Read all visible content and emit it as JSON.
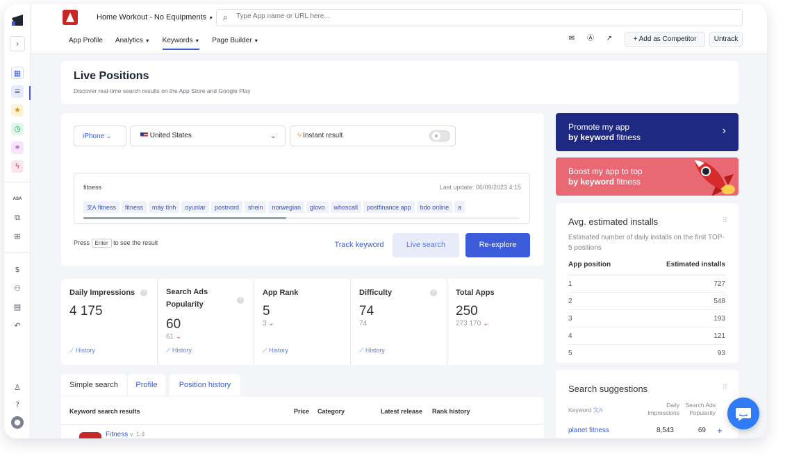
{
  "app": {
    "name": "Home Workout - No Equipments"
  },
  "search": {
    "placeholder": "Type App name or URL here..."
  },
  "nav": {
    "items": [
      "App Profile",
      "Analytics",
      "Keywords",
      "Page Builder"
    ]
  },
  "toolbar": {
    "add_competitor": "Add as Competitor",
    "untrack": "Untrack"
  },
  "page": {
    "title": "Live Positions",
    "subtitle": "Discover real-time search results on the App Store and Google Play"
  },
  "controls": {
    "device": "iPhone",
    "country": "United States",
    "instant": "Instant result"
  },
  "keyword_box": {
    "query": "fitness",
    "last_update": "Last update: 06/09/2023 4:15",
    "chips": [
      "fitness",
      "fitness",
      "máy tính",
      "oyunlar",
      "postnord",
      "shein",
      "norwegian",
      "glovo",
      "whoscall",
      "postfinance app",
      "bdo online",
      "a"
    ]
  },
  "actions": {
    "press": "Press",
    "enter": "Enter",
    "see_result": "to see the result",
    "track": "Track keyword",
    "live": "Live search",
    "reexplore": "Re-explore"
  },
  "stats": [
    {
      "title": "Daily Impressions",
      "value": "4 175",
      "sub": "",
      "history": "History"
    },
    {
      "title": "Search Ads Popularity",
      "value": "60",
      "sub": "61",
      "history": "History"
    },
    {
      "title": "App Rank",
      "value": "5",
      "sub": "3",
      "history": "History"
    },
    {
      "title": "Difficulty",
      "value": "74",
      "sub": "74",
      "history": "History"
    },
    {
      "title": "Total Apps",
      "value": "250",
      "sub": "273 170",
      "history": ""
    }
  ],
  "tabs": [
    "Simple search",
    "Profile",
    "Position history"
  ],
  "results": {
    "headers": {
      "name": "Keyword search results",
      "price": "Price",
      "category": "Category",
      "release": "Latest release",
      "rank": "Rank history"
    },
    "first_row": {
      "app": "Fitness",
      "version": "v. 1.4"
    }
  },
  "promo": {
    "promote_1": "Promote my app",
    "promote_2": "by keyword",
    "keyword": "fitness",
    "boost_1": "Boost my app to top",
    "boost_2": "by keyword",
    "boost_kw": "fitness"
  },
  "installs": {
    "title": "Avg. estimated installs",
    "desc": "Estimated number of daily installs on the first TOP-5 positions",
    "col_pos": "App position",
    "col_est": "Estimated installs",
    "rows": [
      {
        "pos": "1",
        "val": "727"
      },
      {
        "pos": "2",
        "val": "548"
      },
      {
        "pos": "3",
        "val": "193"
      },
      {
        "pos": "4",
        "val": "121"
      },
      {
        "pos": "5",
        "val": "93"
      }
    ]
  },
  "suggestions": {
    "title": "Search suggestions",
    "col_kw": "Keyword",
    "col_daily": "Daily Impressions",
    "col_ads": "Search Ads Popularity",
    "row": {
      "kw": "planet fitness",
      "daily": "8,543",
      "ads": "69"
    }
  },
  "sidebar": {
    "asa": "ASA"
  },
  "colors": {
    "accent": "#3b5bdb",
    "promo_dark": "#1e2a82",
    "promo_red": "#e86874"
  }
}
